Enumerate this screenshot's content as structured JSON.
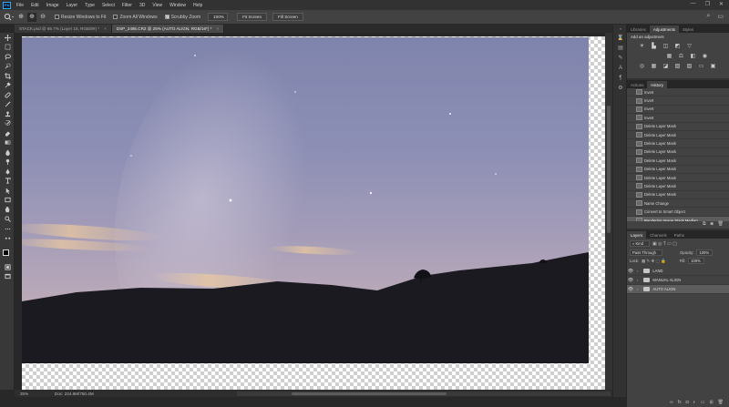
{
  "app": {
    "logo": "Ps"
  },
  "menu": [
    "File",
    "Edit",
    "Image",
    "Layer",
    "Type",
    "Select",
    "Filter",
    "3D",
    "View",
    "Window",
    "Help"
  ],
  "window_controls": [
    "—",
    "❐",
    "✕"
  ],
  "options_bar": {
    "resize_windows_label": "Resize Windows to Fit",
    "zoom_all_label": "Zoom All Windows",
    "scrubby_label": "Scrubby Zoom",
    "zoom_value": "100%",
    "fit_screen_label": "Fit Screen",
    "fill_screen_label": "Fill Screen"
  },
  "doc_tabs": [
    {
      "label": "STACK.psd @ 66.7% (Layer 15, RGB/8#) *",
      "active": false
    },
    {
      "label": "DSP_2495.CR2 @ 25% (AUTO ALIGN, RGB/16*) *",
      "active": true
    }
  ],
  "status": {
    "zoom": "25%",
    "doc": "Doc: 224.8M/750.4M"
  },
  "adjustments": {
    "tabs": [
      "Libraries",
      "Adjustments",
      "Styles"
    ],
    "active": "Adjustments",
    "title": "Add an adjustment"
  },
  "history": {
    "tabs": [
      "Actions",
      "History"
    ],
    "active": "History",
    "items": [
      "Invert",
      "Invert",
      "Invert",
      "Invert",
      "Delete Layer Mask",
      "Delete Layer Mask",
      "Delete Layer Mask",
      "Delete Layer Mask",
      "Delete Layer Mask",
      "Delete Layer Mask",
      "Delete Layer Mask",
      "Delete Layer Mask",
      "Delete Layer Mask",
      "Name Change",
      "Convert to Smart Object",
      "Rendering Image Stack Median"
    ],
    "selected_index": 15
  },
  "layers": {
    "tabs": [
      "Layers",
      "Channels",
      "Paths"
    ],
    "active": "Layers",
    "kind_filter": "Kind",
    "blend_mode": "Pass Through",
    "opacity_label": "Opacity:",
    "opacity_value": "100%",
    "lock_label": "Lock:",
    "fill_label": "Fill:",
    "fill_value": "100%",
    "items": [
      {
        "name": "LAND",
        "visible": true,
        "selected": false
      },
      {
        "name": "MANUAL ALIGN",
        "visible": true,
        "selected": false
      },
      {
        "name": "AUTO ALIGN",
        "visible": true,
        "selected": true
      }
    ]
  },
  "colors": {
    "accent": "#31a8ff",
    "panel": "#424242",
    "selected_row": "#5d5d5d"
  },
  "tools": [
    "move-icon",
    "marquee-icon",
    "lasso-icon",
    "quick-select-icon",
    "crop-icon",
    "eyedropper-icon",
    "healing-brush-icon",
    "brush-icon",
    "clone-stamp-icon",
    "history-brush-icon",
    "eraser-icon",
    "gradient-icon",
    "blur-icon",
    "dodge-icon",
    "pen-icon",
    "type-icon",
    "path-select-icon",
    "rectangle-icon",
    "hand-icon",
    "zoom-icon",
    "more-tools-icon"
  ]
}
